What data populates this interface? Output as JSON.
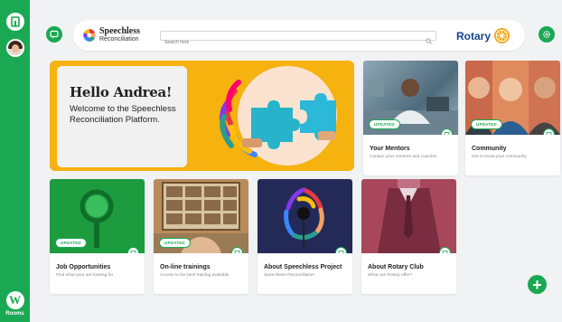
{
  "sidebar": {
    "rooms_label": "Rooms",
    "rooms_icon_letter": "W"
  },
  "header": {
    "brand_line1": "Speechless",
    "brand_line2": "Reconciliation",
    "search_placeholder": "Search here",
    "partner": "Rotary"
  },
  "hero": {
    "greeting": "Hello Andrea!",
    "welcome": "Welcome to the Speechless Reconciliation Platform."
  },
  "cards": [
    {
      "title": "Your Mentors",
      "desc": "Contact your mentors and coaches",
      "badge": "UPDATED"
    },
    {
      "title": "Community",
      "desc": "Get to know your community",
      "badge": "UPDATED"
    },
    {
      "title": "Job Opportunities",
      "desc": "Find what your are looking for",
      "badge": "UPDATED"
    },
    {
      "title": "On-line trainings",
      "desc": "Access to the best training available",
      "badge": "UPDATED"
    },
    {
      "title": "About Speechless Project",
      "desc": "Speechless Reconciliation",
      "badge": ""
    },
    {
      "title": "About Rotary Club",
      "desc": "What can Rotary offer?",
      "badge": ""
    }
  ],
  "colors": {
    "accent": "#1aa853",
    "hero_bg": "#f6b20f",
    "rotary_blue": "#17458f"
  },
  "icons": [
    "home-icon",
    "user-avatar",
    "chat-icon",
    "search-icon",
    "settings-icon",
    "bookmark-icon",
    "plus-icon"
  ]
}
